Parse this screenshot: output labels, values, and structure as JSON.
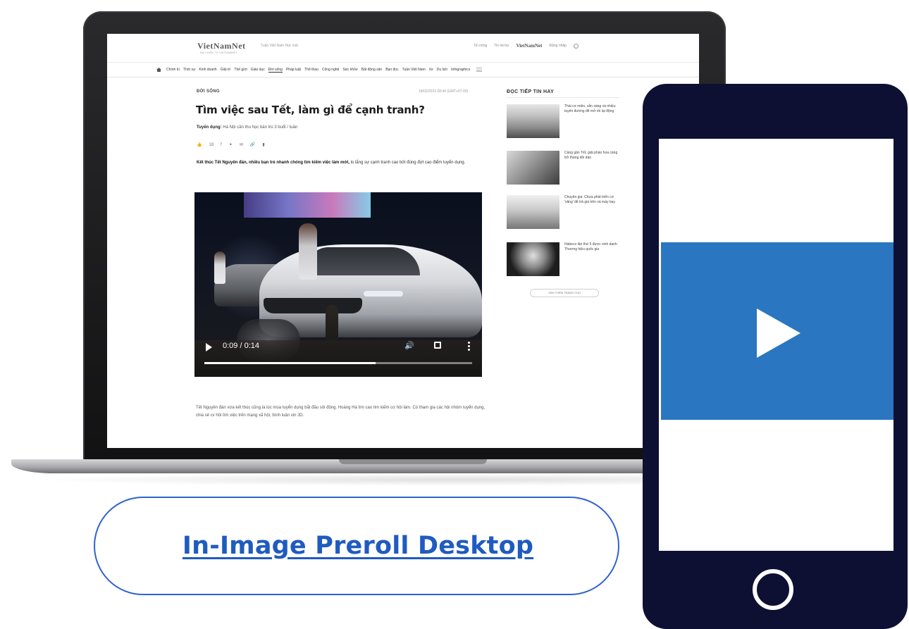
{
  "site": {
    "logo": "VietNamNet",
    "logo_sub": "BÁO ĐIỆN TỬ VIETNAMNET",
    "top_links": "Tuần Việt Nam    Học mãi",
    "top_right_1": "Tin nóng",
    "top_right_2": "Tin tài trợ",
    "top_right_3": "VietNamNet",
    "top_right_4": "Đăng nhập",
    "nav_items": [
      "Chính trị",
      "Thời sự",
      "Kinh doanh",
      "Giải trí",
      "Thế giới",
      "Giáo dục",
      "Đời sống",
      "Pháp luật",
      "Thể thao",
      "Công nghệ",
      "Sức khỏe",
      "Bất động sản",
      "Bạn đọc",
      "Tuần Việt Nam",
      "Xe",
      "Du lịch",
      "Infographics"
    ]
  },
  "article": {
    "category": "ĐỜI SỐNG",
    "date": "18/02/2022   08:44 (GMT+07:00)",
    "headline": "Tìm việc sau Tết, làm gì để cạnh tranh?",
    "author_label": "Tuyển dụng:",
    "author_text": "Hà Nội cần thu học bán trú 3 buổi / tuần",
    "share_count": "18",
    "sapo_bold": "Kết thúc Tết Nguyên đán, nhiều bạn trẻ nhanh chóng tìm kiếm việc làm mới,",
    "sapo_rest": " lo lắng sự cạnh tranh cao bởi đúng đợt cao điểm tuyển dụng.",
    "body": "Tết Nguyên đán vừa kết thúc cũng là lúc mùa tuyển dụng bắt đầu sôi động. Hoàng Hà tìm cao tìm kiếm cơ hội làm. Có tham gia các hội nhóm tuyển dụng, chia sẻ cv hồi tìm việc trên mạng xã hội, bình luận xin JD."
  },
  "video": {
    "time_display": "0:09 / 0:14",
    "progress": 0.64
  },
  "sidebar": {
    "title": "ĐỌC TIẾP TIN HAY",
    "items": [
      "Thái cơ miền, sẵn sàng và nhiều tuyến đường để mở rồi lại động",
      "Càng gần Tết, giải pháo hoa càng trở thàng dồi dào",
      "Chuyên gia: Chưa phát triển cơ 'xăng' để trả giá trên và máy bay",
      "Habeco lần thứ 5 được vinh danh Thương hiệu quốc gia"
    ],
    "more_button": "XEM THÊM TRANG CHỦ"
  },
  "cta": {
    "label": "In-Image Preroll Desktop",
    "border_color": "#2f63cf",
    "text_color": "#1f5bc0"
  },
  "phone": {
    "body_color": "#0e1033",
    "video_color": "#2a76c1",
    "icons": [
      "play-icon",
      "home-button-icon"
    ]
  }
}
